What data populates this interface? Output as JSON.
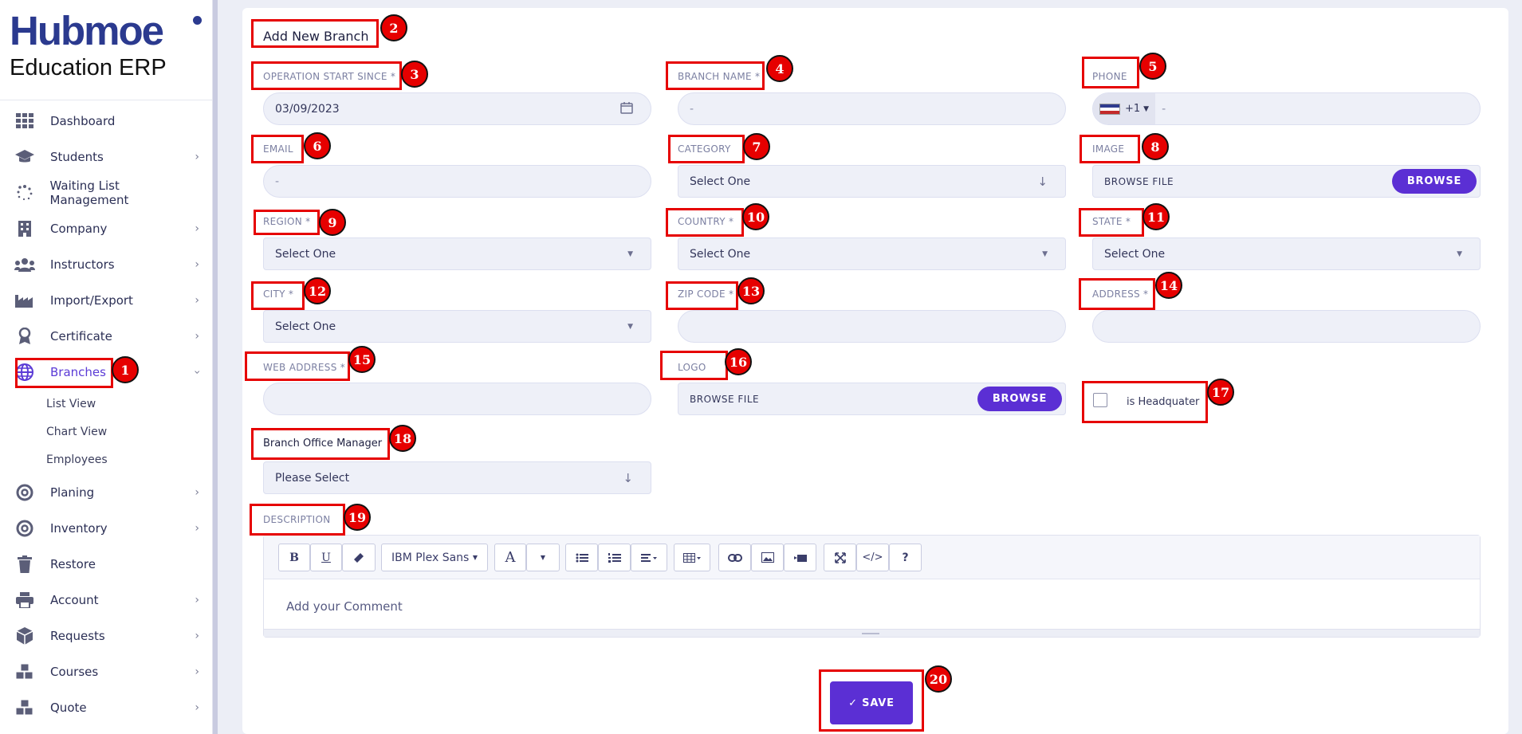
{
  "app": {
    "brand": "Hubmoe",
    "subtitle": "Education ERP"
  },
  "sidebar": {
    "items": [
      {
        "label": "Dashboard",
        "icon": "grid-icon",
        "has_chevron": false
      },
      {
        "label": "Students",
        "icon": "graduation-cap-icon",
        "has_chevron": true
      },
      {
        "label": "Waiting List Management",
        "icon": "spinner-icon",
        "has_chevron": false
      },
      {
        "label": "Company",
        "icon": "building-icon",
        "has_chevron": true
      },
      {
        "label": "Instructors",
        "icon": "users-icon",
        "has_chevron": true
      },
      {
        "label": "Import/Export",
        "icon": "industry-icon",
        "has_chevron": true
      },
      {
        "label": "Certificate",
        "icon": "award-icon",
        "has_chevron": true
      },
      {
        "label": "Branches",
        "icon": "globe-icon",
        "has_chevron": true,
        "active": true
      },
      {
        "label": "Planing",
        "icon": "target-icon",
        "has_chevron": true
      },
      {
        "label": "Inventory",
        "icon": "target-icon",
        "has_chevron": true
      },
      {
        "label": "Restore",
        "icon": "trash-icon",
        "has_chevron": false
      },
      {
        "label": "Account",
        "icon": "printer-icon",
        "has_chevron": true
      },
      {
        "label": "Requests",
        "icon": "box-icon",
        "has_chevron": true
      },
      {
        "label": "Courses",
        "icon": "cubes-icon",
        "has_chevron": true
      },
      {
        "label": "Quote",
        "icon": "cubes-icon",
        "has_chevron": true
      }
    ],
    "branches_sub": [
      "List View",
      "Chart View",
      "Employees"
    ]
  },
  "form": {
    "title": "Add New Branch",
    "operation_start": {
      "label": "OPERATION START SINCE *",
      "value": "03/09/2023"
    },
    "branch_name": {
      "label": "BRANCH NAME *",
      "placeholder": "-"
    },
    "phone": {
      "label": "PHONE",
      "code": "+1",
      "placeholder": "-"
    },
    "email": {
      "label": "EMAIL",
      "placeholder": "-"
    },
    "category": {
      "label": "CATEGORY",
      "value": "Select One"
    },
    "image": {
      "label": "IMAGE",
      "file_text": "BROWSE FILE",
      "button": "BROWSE"
    },
    "region": {
      "label": "REGION *",
      "value": "Select One"
    },
    "country": {
      "label": "COUNTRY *",
      "value": "Select One"
    },
    "state": {
      "label": "STATE *",
      "value": "Select One"
    },
    "city": {
      "label": "CITY *",
      "value": "Select One"
    },
    "zip": {
      "label": "ZIP CODE *"
    },
    "address": {
      "label": "ADDRESS *"
    },
    "web": {
      "label": "WEB ADDRESS *"
    },
    "logo": {
      "label": "LOGO",
      "file_text": "BROWSE FILE",
      "button": "BROWSE"
    },
    "headquarter": {
      "label": "is Headquater",
      "checked": false
    },
    "manager": {
      "label": "Branch Office Manager",
      "value": "Please Select"
    },
    "description": {
      "label": "DESCRIPTION",
      "font": "IBM Plex Sans",
      "placeholder": "Add your Comment"
    },
    "save": "✓  SAVE"
  },
  "badges": [
    "1",
    "2",
    "3",
    "4",
    "5",
    "6",
    "7",
    "8",
    "9",
    "10",
    "11",
    "12",
    "13",
    "14",
    "15",
    "16",
    "17",
    "18",
    "19",
    "20"
  ],
  "colors": {
    "accent": "#5b2fd4",
    "annotation": "#e60000"
  }
}
